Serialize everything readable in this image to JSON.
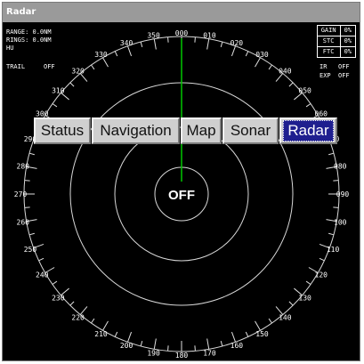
{
  "window": {
    "title": "Radar"
  },
  "status_readouts": {
    "range": "RANGE: 0.0NM",
    "rings": "RINGS: 0.0NM",
    "orientation": "HU",
    "trail_label": "TRAIL",
    "trail_value": "OFF"
  },
  "gain_table": {
    "rows": [
      {
        "label": "GAIN",
        "value": "0%"
      },
      {
        "label": "STC",
        "value": "0%"
      },
      {
        "label": "FTC",
        "value": "0%"
      }
    ]
  },
  "ir": {
    "label": "IR",
    "value": "OFF"
  },
  "exp": {
    "label": "EXP",
    "value": "OFF"
  },
  "tabs": [
    {
      "label": "Status",
      "active": false
    },
    {
      "label": "Navigation",
      "active": false
    },
    {
      "label": "Map",
      "active": false
    },
    {
      "label": "Sonar",
      "active": false
    },
    {
      "label": "Radar",
      "active": true
    }
  ],
  "radar": {
    "center_text": "OFF",
    "heading_line_color": "#00c800",
    "bearing_labels": [
      "000",
      "010",
      "020",
      "030",
      "040",
      "050",
      "060",
      "070",
      "080",
      "090",
      "100",
      "110",
      "120",
      "130",
      "140",
      "150",
      "160",
      "170",
      "180",
      "190",
      "200",
      "210",
      "220",
      "230",
      "240",
      "250",
      "260",
      "270",
      "280",
      "290",
      "300",
      "310",
      "320",
      "330",
      "340",
      "350"
    ]
  }
}
